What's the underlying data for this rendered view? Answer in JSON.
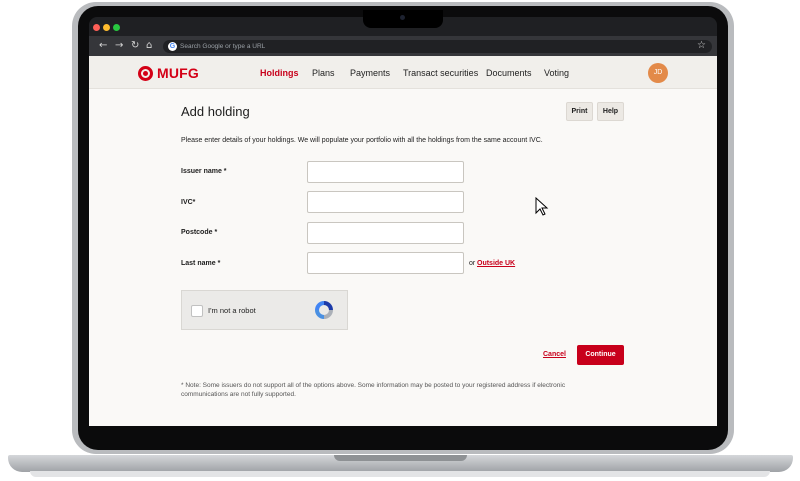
{
  "browser": {
    "address_placeholder": "Search Google or type a URL",
    "back_icon": "arrow-left-icon",
    "forward_icon": "arrow-right-icon",
    "reload_icon": "reload-icon",
    "home_icon": "home-icon",
    "bookmark_icon": "star-icon"
  },
  "site": {
    "logo_text": "MUFG",
    "brand_color": "#d40016",
    "nav": [
      "Holdings",
      "Plans",
      "Payments",
      "Transact securities",
      "Documents",
      "Voting"
    ],
    "active_nav": "Holdings",
    "avatar_initials": "JD"
  },
  "page": {
    "title": "Add holding",
    "print_label": "Print",
    "help_label": "Help",
    "intro": "Please enter details of your holdings. We will populate your portfolio with all the holdings from the same account IVC."
  },
  "form": {
    "issuer_label": "Issuer name *",
    "ivc_label": "IVC*",
    "postcode_label": "Postcode *",
    "lastname_label": "Last name *",
    "issuer_value": "",
    "ivc_value": "",
    "postcode_value": "",
    "lastname_value": "",
    "or_text": "or",
    "outside_uk_label": "Outside UK"
  },
  "captcha": {
    "label": "I'm not a robot"
  },
  "actions": {
    "cancel_label": "Cancel",
    "continue_label": "Continue"
  },
  "note": "* Note: Some issuers do not support all of the options above. Some information may be posted to your registered address if electronic communications are not fully supported."
}
